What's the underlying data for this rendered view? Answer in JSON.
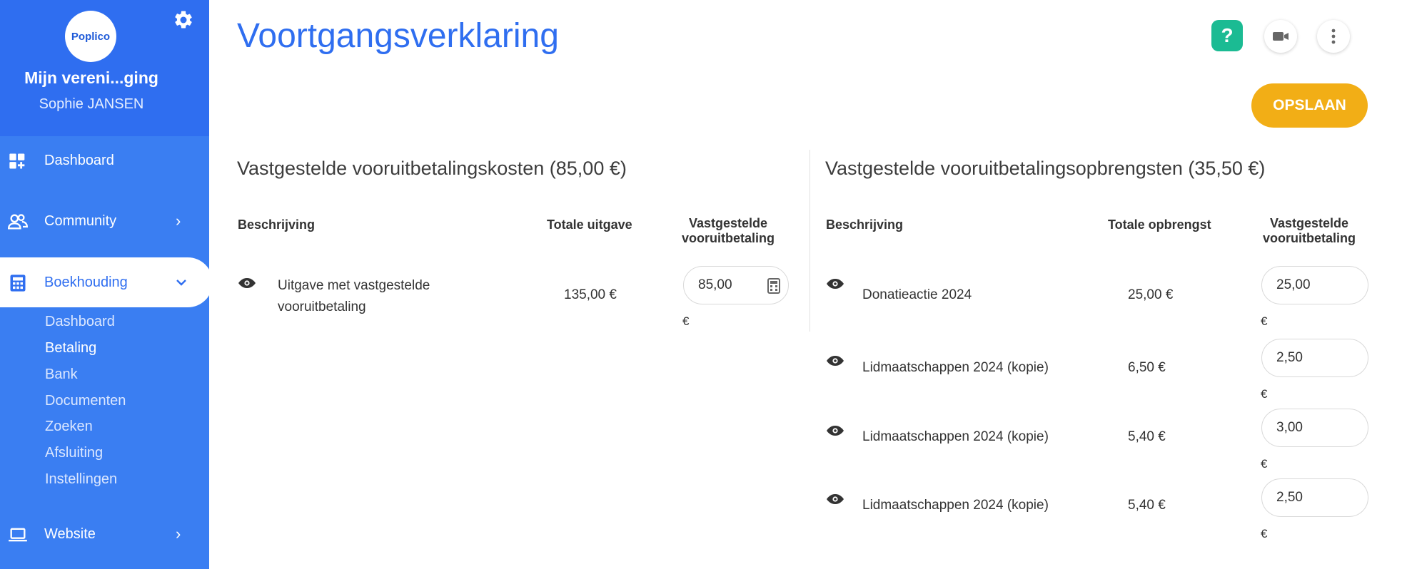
{
  "sidebar": {
    "logo_text": "Poplico",
    "org_name": "Mijn vereni...ging",
    "user_name": "Sophie JANSEN",
    "items": [
      {
        "label": "Dashboard",
        "icon": "dashboard-icon"
      },
      {
        "label": "Community",
        "icon": "community-icon"
      },
      {
        "label": "Boekhouding",
        "icon": "calculator-icon"
      },
      {
        "label": "Website",
        "icon": "laptop-icon"
      }
    ],
    "submenu": [
      "Dashboard",
      "Betaling",
      "Bank",
      "Documenten",
      "Zoeken",
      "Afsluiting",
      "Instellingen"
    ]
  },
  "header": {
    "title": "Voortgangsverklaring",
    "help_label": "?",
    "save_label": "OPSLAAN"
  },
  "costs": {
    "title": "Vastgestelde vooruitbetalingskosten (85,00 €)",
    "col_description": "Beschrijving",
    "col_total": "Totale uitgave",
    "col_prepaid_1": "Vastgestelde",
    "col_prepaid_2": "vooruitbetaling",
    "rows": [
      {
        "desc_1": "Uitgave met vastgestelde",
        "desc_2": "vooruitbetaling",
        "total": "135,00 €",
        "prepaid": "85,00",
        "currency": "€"
      }
    ]
  },
  "revenues": {
    "title": "Vastgestelde vooruitbetalingsopbrengsten (35,50 €)",
    "col_description": "Beschrijving",
    "col_total": "Totale opbrengst",
    "col_prepaid_1": "Vastgestelde",
    "col_prepaid_2": "vooruitbetaling",
    "rows": [
      {
        "desc": "Donatieactie 2024",
        "total": "25,00 €",
        "prepaid": "25,00",
        "currency": "€"
      },
      {
        "desc": "Lidmaatschappen 2024 (kopie)",
        "total": "6,50 €",
        "prepaid": "2,50",
        "currency": "€"
      },
      {
        "desc": "Lidmaatschappen 2024 (kopie)",
        "total": "5,40 €",
        "prepaid": "3,00",
        "currency": "€"
      },
      {
        "desc": "Lidmaatschappen 2024 (kopie)",
        "total": "5,40 €",
        "prepaid": "2,50",
        "currency": "€"
      }
    ]
  },
  "colors": {
    "sidebar": "#3a7ef2",
    "accent_blue": "#2f6ef0",
    "save_button": "#f2ae16",
    "help_button": "#1bbb93"
  }
}
